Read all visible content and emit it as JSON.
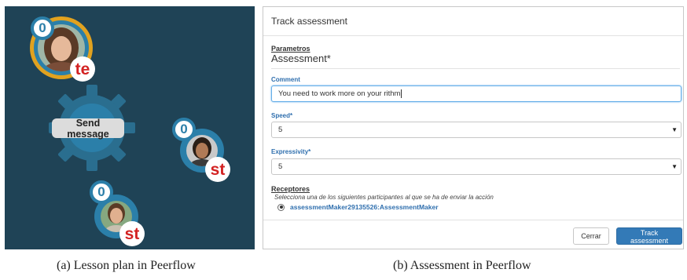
{
  "lesson_plan": {
    "nodes": [
      {
        "count": "0",
        "role": "te"
      },
      {
        "count": "0",
        "role": "st"
      },
      {
        "count": "0",
        "role": "st"
      }
    ],
    "send_message_label": "Send message",
    "colors": {
      "background": "#1f4356",
      "ring_teal": "#2b7fa9",
      "ring_gold": "#e1a21f",
      "role_red": "#d32222"
    }
  },
  "assessment_modal": {
    "title": "Track assessment",
    "parametros_label": "Parametros",
    "assessment_label": "Assessment*",
    "comment_label": "Comment",
    "comment_value": "You need to work more on your rithm",
    "speed_label": "Speed*",
    "speed_value": "5",
    "expressivity_label": "Expressivity*",
    "expressivity_value": "5",
    "receptores_label": "Receptores",
    "receptores_help": "Selecciona una de los siguientes participantes al que se ha de enviar la acción",
    "recipient_option": "assessmentMaker29135526:AssessmentMaker",
    "cancel_label": "Cerrar",
    "submit_label": "Track assessment",
    "colors": {
      "primary": "#337ab7",
      "label_blue": "#2f6fae"
    }
  },
  "captions": {
    "left": "(a)  Lesson plan in Peerflow",
    "right": "(b)  Assessment in Peerflow"
  }
}
